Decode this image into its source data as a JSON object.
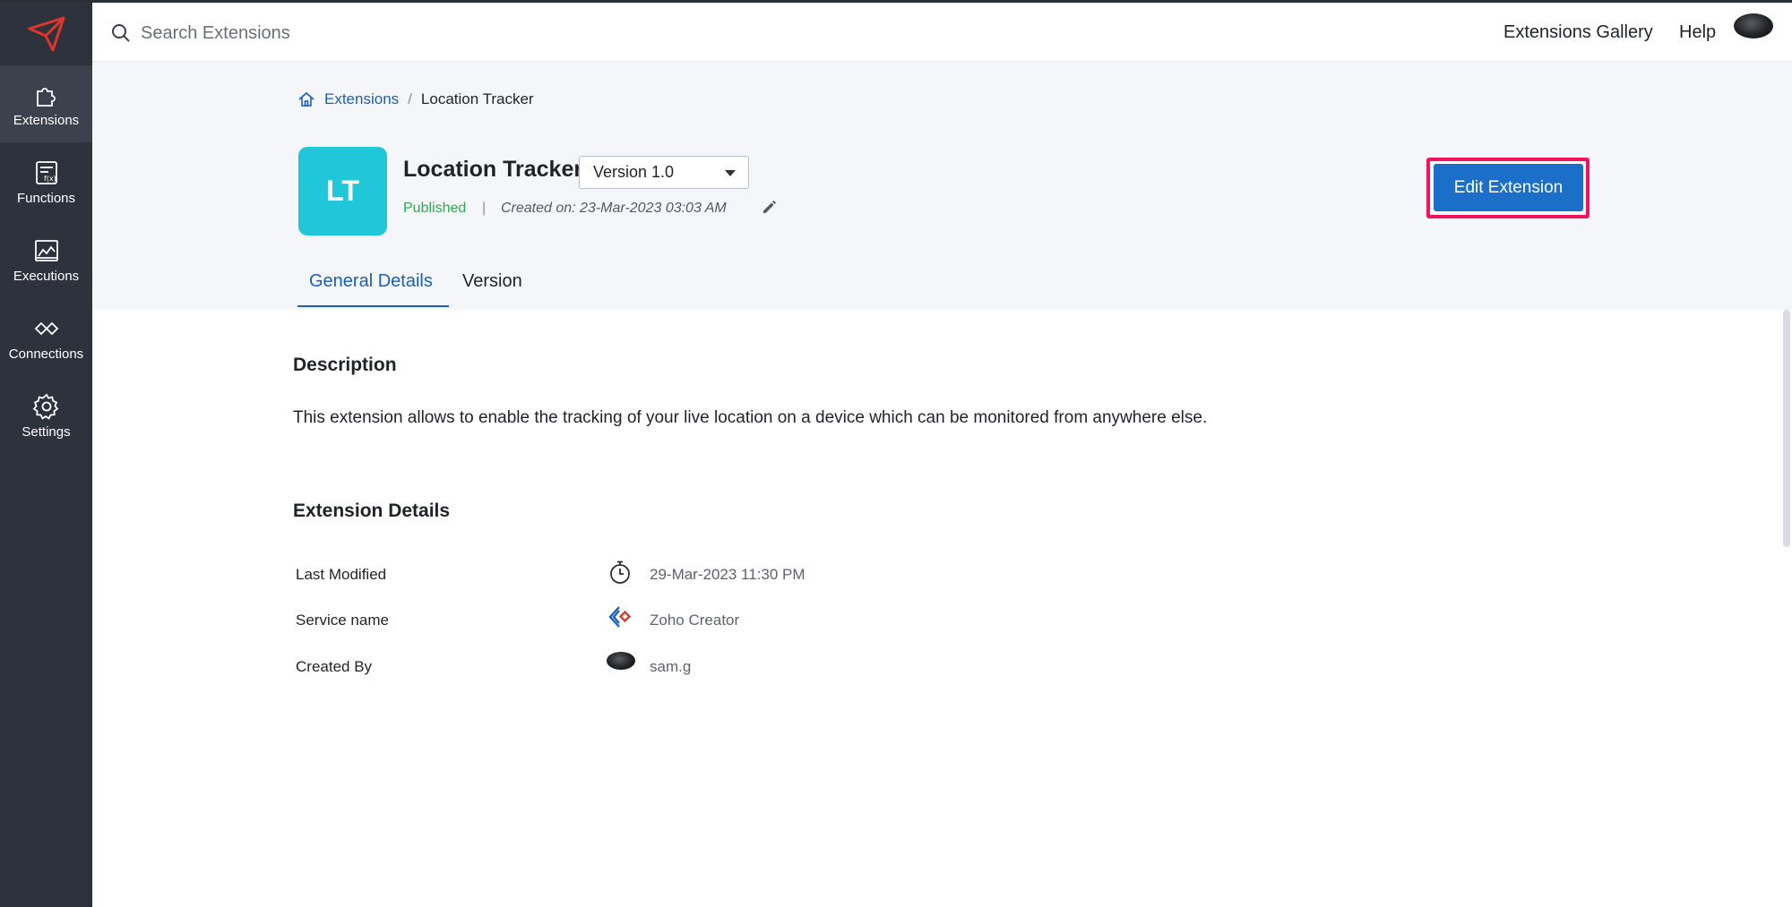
{
  "search": {
    "placeholder": "Search Extensions"
  },
  "topnav": {
    "gallery": "Extensions Gallery",
    "help": "Help"
  },
  "sidebar": {
    "items": [
      {
        "label": "Extensions",
        "icon": "puzzle-icon"
      },
      {
        "label": "Functions",
        "icon": "function-icon"
      },
      {
        "label": "Executions",
        "icon": "chart-icon"
      },
      {
        "label": "Connections",
        "icon": "link-icon"
      },
      {
        "label": "Settings",
        "icon": "gear-icon"
      }
    ]
  },
  "breadcrumb": {
    "parent": "Extensions",
    "separator": "/",
    "current": "Location Tracker"
  },
  "extension": {
    "initials": "LT",
    "name": "Location Tracker",
    "version": "Version 1.0",
    "status": "Published",
    "separator": "|",
    "created": "Created on: 23-Mar-2023 03:03 AM"
  },
  "actions": {
    "edit": "Edit Extension"
  },
  "tabs": [
    {
      "label": "General Details"
    },
    {
      "label": "Version"
    }
  ],
  "description": {
    "title": "Description",
    "text": "This extension allows to enable the tracking of your live location on a device which can be monitored from anywhere else."
  },
  "details": {
    "title": "Extension Details",
    "rows": [
      {
        "label": "Last Modified",
        "value": "29-Mar-2023 11:30 PM",
        "icon": "stopwatch-icon"
      },
      {
        "label": "Service name",
        "value": "Zoho Creator",
        "icon": "zoho-creator-icon"
      },
      {
        "label": "Created By",
        "value": "sam.g",
        "icon": "avatar"
      }
    ]
  },
  "colors": {
    "accent": "#1b6fc9",
    "highlight": "#f0145a",
    "published": "#2fa84f",
    "logo_bg": "#20c7d8",
    "sidebar": "#2d323d"
  }
}
